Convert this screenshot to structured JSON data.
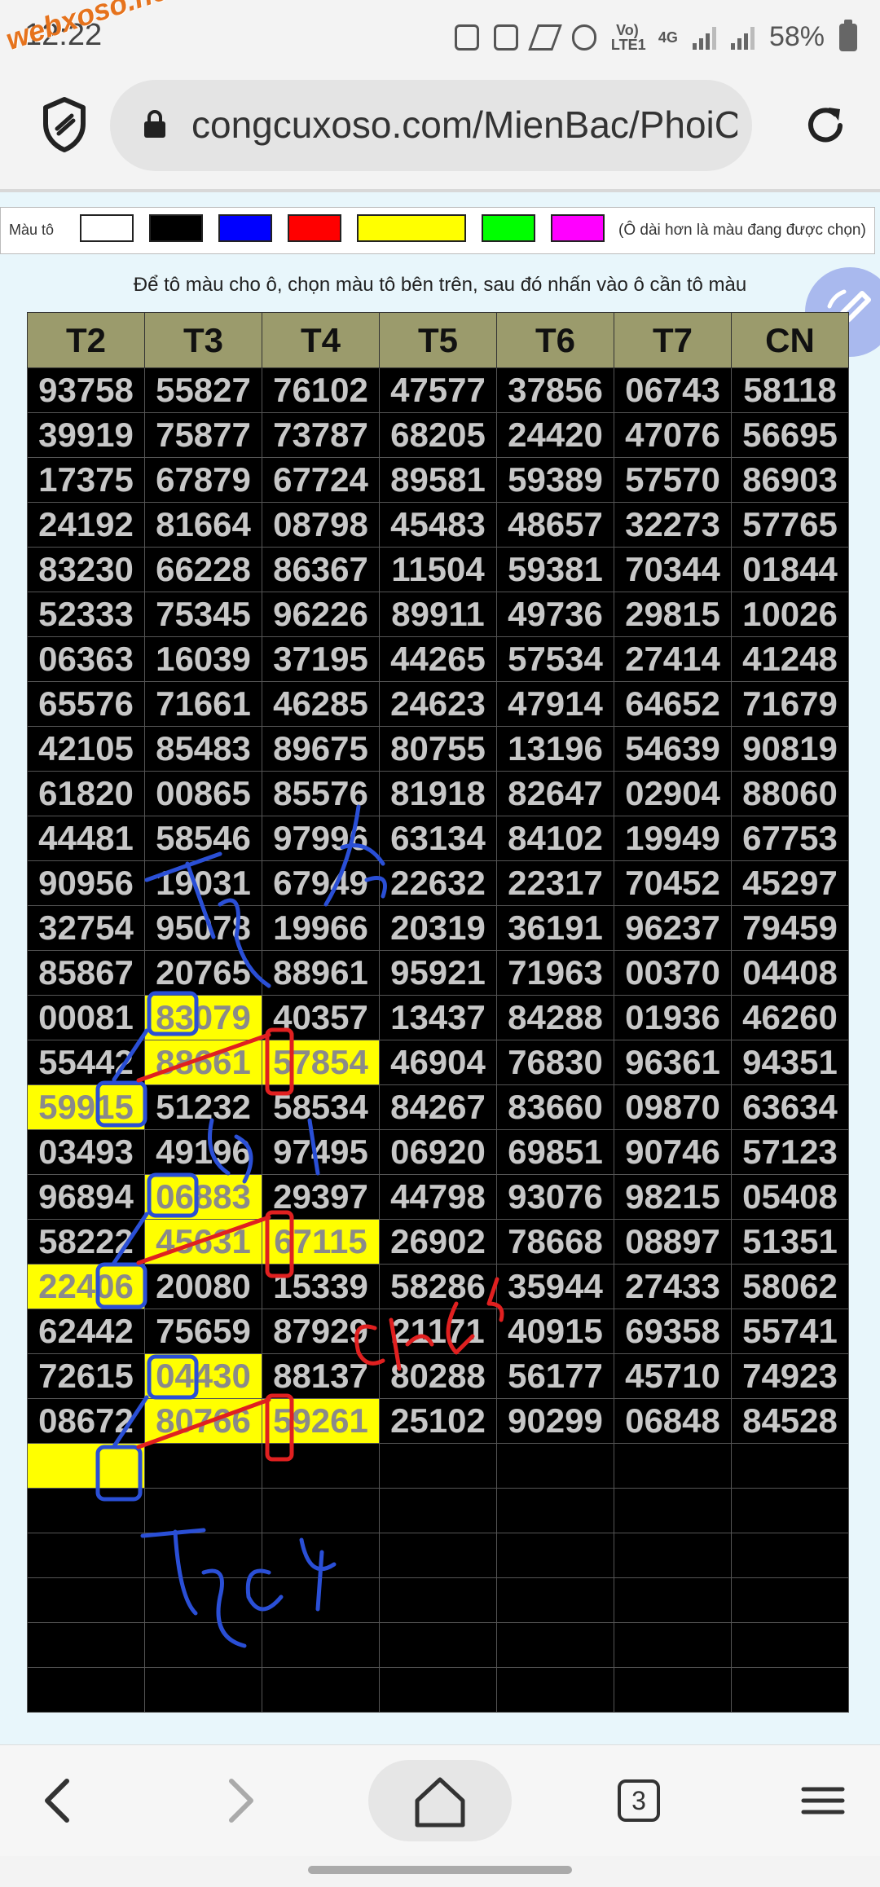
{
  "status": {
    "time": "12:22",
    "watermark": "webxoso.net",
    "network": "Vo) LTE1",
    "net_type": "4G",
    "battery": "58%"
  },
  "browser": {
    "url": "congcuxoso.com/MienBac/PhoiCa"
  },
  "palette": {
    "label": "Màu tô",
    "colors": [
      "#ffffff",
      "#000000",
      "#0000ff",
      "#ff0000",
      "#ffff00",
      "#00ff00",
      "#ff00ff"
    ],
    "note": "(Ô dài hơn là màu đang được chọn)"
  },
  "instruction": "Để tô màu cho ô, chọn màu tô bên trên, sau đó nhấn vào ô cần tô màu",
  "table": {
    "headers": [
      "T2",
      "T3",
      "T4",
      "T5",
      "T6",
      "T7",
      "CN"
    ],
    "rows": [
      [
        "93758",
        "55827",
        "76102",
        "47577",
        "37856",
        "06743",
        "58118"
      ],
      [
        "39919",
        "75877",
        "73787",
        "68205",
        "24420",
        "47076",
        "56695"
      ],
      [
        "17375",
        "67879",
        "67724",
        "89581",
        "59389",
        "57570",
        "86903"
      ],
      [
        "24192",
        "81664",
        "08798",
        "45483",
        "48657",
        "32273",
        "57765"
      ],
      [
        "83230",
        "66228",
        "86367",
        "11504",
        "59381",
        "70344",
        "01844"
      ],
      [
        "52333",
        "75345",
        "96226",
        "89911",
        "49736",
        "29815",
        "10026"
      ],
      [
        "06363",
        "16039",
        "37195",
        "44265",
        "57534",
        "27414",
        "41248"
      ],
      [
        "65576",
        "71661",
        "46285",
        "24623",
        "47914",
        "64652",
        "71679"
      ],
      [
        "42105",
        "85483",
        "89675",
        "80755",
        "13196",
        "54639",
        "90819"
      ],
      [
        "61820",
        "00865",
        "85576",
        "81918",
        "82647",
        "02904",
        "88060"
      ],
      [
        "44481",
        "58546",
        "97996",
        "63134",
        "84102",
        "19949",
        "67753"
      ],
      [
        "90956",
        "19031",
        "67949",
        "22632",
        "22317",
        "70452",
        "45297"
      ],
      [
        "32754",
        "95078",
        "19966",
        "20319",
        "36191",
        "96237",
        "79459"
      ],
      [
        "85867",
        "20765",
        "88961",
        "95921",
        "71963",
        "00370",
        "04408"
      ],
      [
        "00081",
        "83079",
        "40357",
        "13437",
        "84288",
        "01936",
        "46260"
      ],
      [
        "55442",
        "88661",
        "57854",
        "46904",
        "76830",
        "96361",
        "94351"
      ],
      [
        "59915",
        "51232",
        "58534",
        "84267",
        "83660",
        "09870",
        "63634"
      ],
      [
        "03493",
        "49196",
        "97495",
        "06920",
        "69851",
        "90746",
        "57123"
      ],
      [
        "96894",
        "06883",
        "29397",
        "44798",
        "93076",
        "98215",
        "05408"
      ],
      [
        "58222",
        "45631",
        "67115",
        "26902",
        "78668",
        "08897",
        "51351"
      ],
      [
        "22406",
        "20080",
        "15339",
        "58286",
        "35944",
        "27433",
        "58062"
      ],
      [
        "62442",
        "75659",
        "87929",
        "21171",
        "40915",
        "69358",
        "55741"
      ],
      [
        "72615",
        "04430",
        "88137",
        "80288",
        "56177",
        "45710",
        "74923"
      ],
      [
        "08672",
        "80766",
        "59261",
        "25102",
        "90299",
        "06848",
        "84528"
      ],
      [
        "",
        "",
        "",
        "",
        "",
        "",
        ""
      ],
      [
        "",
        "",
        "",
        "",
        "",
        "",
        ""
      ],
      [
        "",
        "",
        "",
        "",
        "",
        "",
        ""
      ],
      [
        "",
        "",
        "",
        "",
        "",
        "",
        ""
      ],
      [
        "",
        "",
        "",
        "",
        "",
        "",
        ""
      ],
      [
        "",
        "",
        "",
        "",
        "",
        "",
        ""
      ]
    ],
    "highlights": [
      [
        14,
        1
      ],
      [
        15,
        1
      ],
      [
        15,
        2
      ],
      [
        16,
        0
      ],
      [
        18,
        1
      ],
      [
        19,
        1
      ],
      [
        19,
        2
      ],
      [
        20,
        0
      ],
      [
        22,
        1
      ],
      [
        23,
        1
      ],
      [
        23,
        2
      ],
      [
        24,
        0
      ]
    ],
    "highlight_color": "#ffff00"
  },
  "annotations": {
    "note1": "Tổng",
    "note2": "1 rồi",
    "note3": "Đề",
    "note4": "1d",
    "note5": "chạm 5",
    "note6": "Tây 4,9"
  },
  "nav": {
    "tab_count": "3"
  }
}
